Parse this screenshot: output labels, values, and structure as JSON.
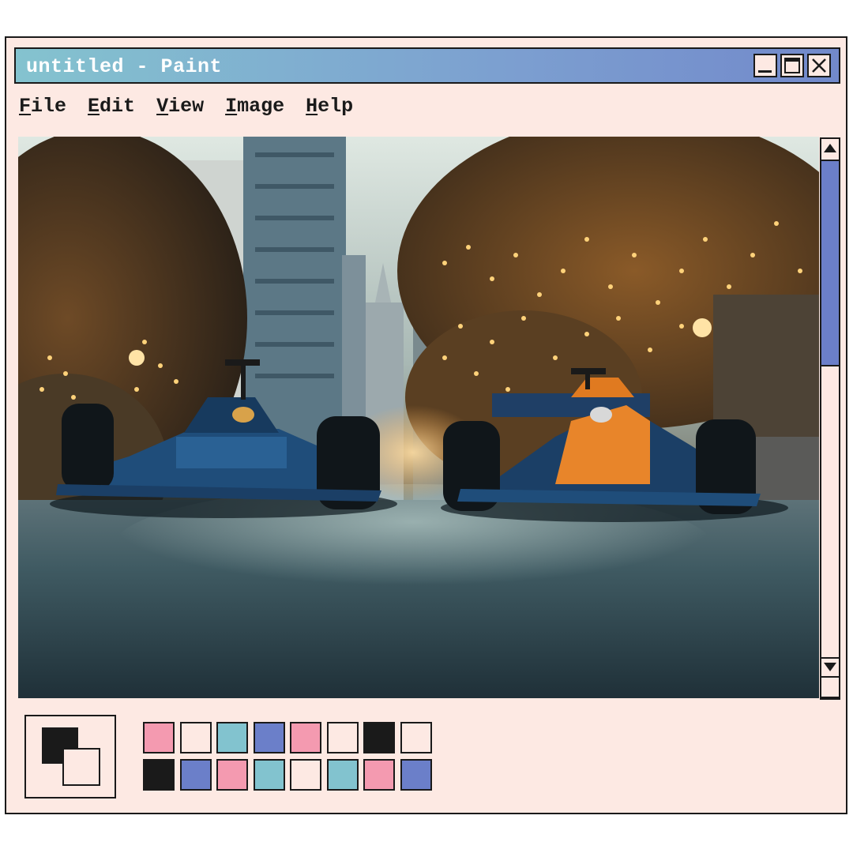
{
  "window": {
    "title": "untitled - Paint",
    "controls": [
      "minimize",
      "maximize",
      "close"
    ]
  },
  "menu": [
    {
      "label": "File",
      "accel": "F",
      "rest": "ile"
    },
    {
      "label": "Edit",
      "accel": "E",
      "rest": "dit"
    },
    {
      "label": "View",
      "accel": "V",
      "rest": "iew"
    },
    {
      "label": "Image",
      "accel": "I",
      "rest": "mage"
    },
    {
      "label": "Help",
      "accel": "H",
      "rest": "elp"
    }
  ],
  "colors": {
    "foreground": "#1a1a1a",
    "background": "#fde9e3",
    "title_gradient": [
      "#84c3cf",
      "#7289cb"
    ],
    "scroll_thumb": "#6b7fc9"
  },
  "palette": {
    "row1": [
      "#f49ab0",
      "#fde9e3",
      "#82c3cf",
      "#6b7fc9",
      "#f49ab0",
      "#fde9e3",
      "#1a1a1a",
      "#fde9e3"
    ],
    "row2": [
      "#1a1a1a",
      "#6b7fc9",
      "#f49ab0",
      "#82c3cf",
      "#fde9e3",
      "#82c3cf",
      "#f49ab0",
      "#6b7fc9"
    ]
  },
  "scrollbar": {
    "position_fraction": 0.0,
    "visible_fraction": 0.39
  },
  "canvas_image": {
    "subject": "two formula racing cars on a city street at dusk",
    "cars": [
      "blue car",
      "orange car"
    ]
  }
}
